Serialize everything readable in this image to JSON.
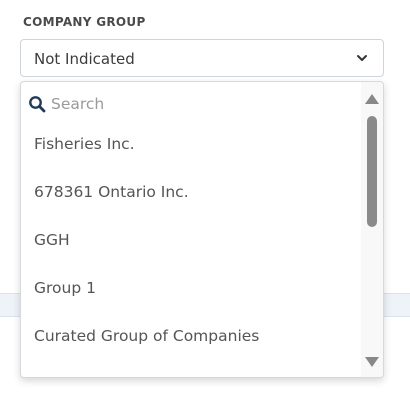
{
  "field": {
    "label": "COMPANY GROUP",
    "selected_value": "Not Indicated"
  },
  "dropdown": {
    "search_placeholder": "Search",
    "options": [
      "Fisheries Inc.",
      "678361 Ontario Inc.",
      "GGH",
      "Group 1",
      "Curated Group of Companies"
    ]
  },
  "icons": {
    "chevron": "chevron-down-icon",
    "search": "search-icon",
    "scroll_up": "scroll-up-arrow-icon",
    "scroll_down": "scroll-down-arrow-icon"
  },
  "colors": {
    "search_icon": "#1f3b57",
    "scrollbar_thumb": "#8a8a8a"
  }
}
